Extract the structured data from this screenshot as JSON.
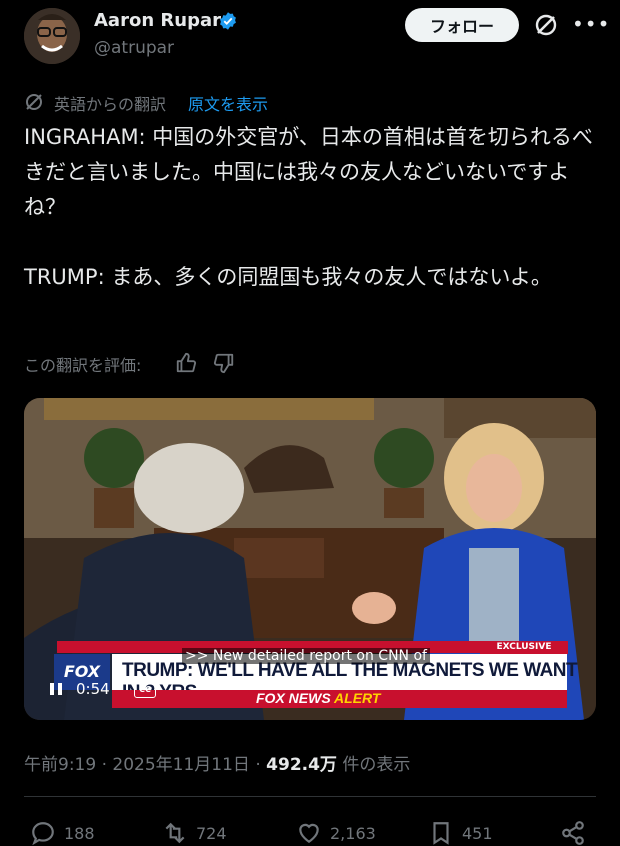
{
  "author": {
    "name": "Aaron Rupar",
    "handle": "@atrupar",
    "follow_label": "フォロー"
  },
  "translation": {
    "label": "英語からの翻訳",
    "show_original": "原文を表示"
  },
  "tweet": {
    "text": "INGRAHAM: 中国の外交官が、日本の首相は首を切られるべきだと言いました。中国には我々の友人などいないですよね？\n\nTRUMP: まあ、多くの同盟国も我々の友人ではないよ。"
  },
  "rate": {
    "label": "この翻訳を評価:"
  },
  "video": {
    "caption": ">> New detailed report on CNN of",
    "exclusive": "EXCLUSIVE",
    "fox_logo": "FOX",
    "headline": "TRUMP: WE'LL HAVE ALL THE MAGNETS WE WANT IN 2 YRS",
    "alert_left": "FOX NEWS",
    "alert_right": "ALERT",
    "timecode": "0:54",
    "cc": "CC"
  },
  "meta": {
    "time": "午前9:19",
    "date": "2025年11月11日",
    "views": "492.4万",
    "views_label": "件の表示"
  },
  "actions": {
    "replies": "188",
    "reposts": "724",
    "likes": "2,163",
    "bookmarks": "451"
  },
  "icons": [
    "avatar",
    "verified-icon",
    "grok-icon",
    "more-icon",
    "translate-icon",
    "thumbs-up-icon",
    "thumbs-down-icon",
    "play-icon",
    "cc-icon",
    "reply-icon",
    "repost-icon",
    "like-icon",
    "bookmark-icon",
    "share-icon"
  ],
  "colors": {
    "accent": "#1d9bf0",
    "secondary_text": "#71767b",
    "fox_red": "#c8102e"
  }
}
